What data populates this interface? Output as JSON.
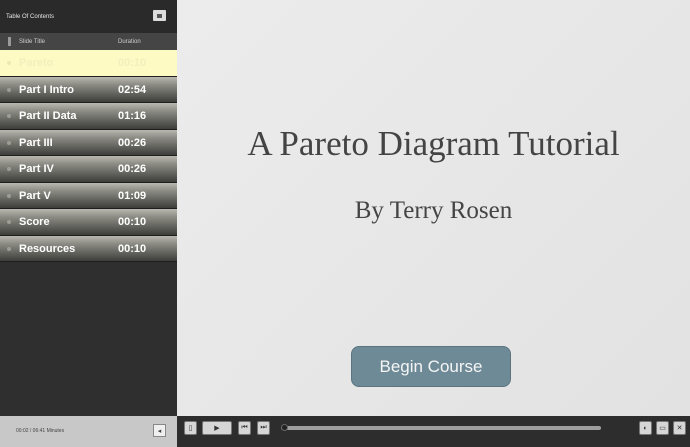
{
  "sidebar": {
    "title": "Table Of Contents",
    "col_title": "Slide Title",
    "col_duration": "Duration",
    "items": [
      {
        "title": "Pareto",
        "duration": "00:10"
      },
      {
        "title": "Part I Intro",
        "duration": "02:54"
      },
      {
        "title": "Part II Data",
        "duration": "01:16"
      },
      {
        "title": "Part III",
        "duration": "00:26"
      },
      {
        "title": "Part IV",
        "duration": "00:26"
      },
      {
        "title": "Part V",
        "duration": "01:09"
      },
      {
        "title": "Score",
        "duration": "00:10"
      },
      {
        "title": "Resources",
        "duration": "00:10"
      }
    ],
    "time_display": "00:02 / 06:41 Minutes"
  },
  "slide": {
    "title": "A Pareto Diagram Tutorial",
    "author": "By Terry Rosen",
    "begin_button": "Begin Course"
  },
  "controls": {
    "icons": {
      "toc_toggle": "list-icon",
      "volume": "volume-icon",
      "cc": "cc-icon",
      "play": "play-icon",
      "prev": "previous-icon",
      "next": "next-icon",
      "captions": "captions-icon",
      "settings": "settings-icon",
      "close": "close-icon"
    },
    "progress": 0.005
  },
  "colors": {
    "active_row": "#fdfac3",
    "button": "#6e8a96",
    "slide_bg": "#e6e6e6"
  }
}
